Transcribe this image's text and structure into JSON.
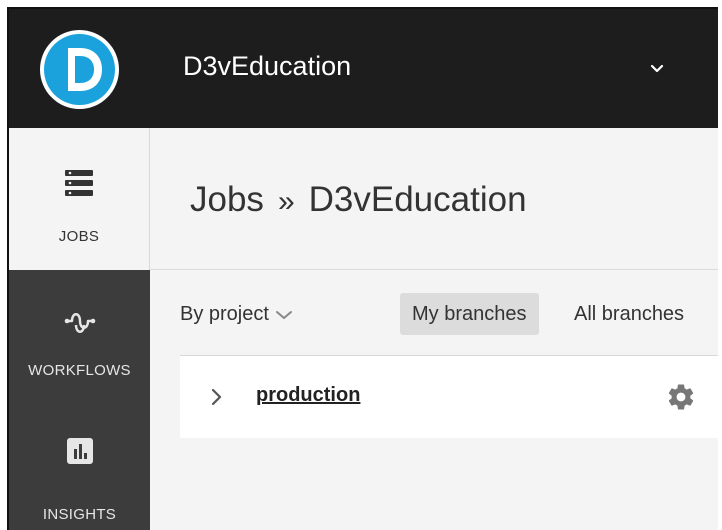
{
  "topbar": {
    "org_name": "D3vEducation",
    "logo_icon": "circleci-org-logo-icon",
    "org_menu_icon": "chevron-down-icon",
    "logo_color": "#1ba1dc",
    "background": "#1d1d1d"
  },
  "sidebar": {
    "items": [
      {
        "label": "JOBS",
        "icon": "jobs-stack-icon",
        "active": true
      },
      {
        "label": "WORKFLOWS",
        "icon": "workflows-icon",
        "active": false
      },
      {
        "label": "INSIGHTS",
        "icon": "insights-chart-icon",
        "active": false
      }
    ]
  },
  "main": {
    "breadcrumb": {
      "root": "Jobs",
      "separator": "»",
      "current": "D3vEducation"
    },
    "filter": {
      "group_by": "By project",
      "my_branches": "My branches",
      "all_branches": "All branches",
      "selected": "My branches"
    },
    "projects": [
      {
        "name": "production",
        "expand_icon": "chevron-right-icon",
        "settings_icon": "gear-icon"
      }
    ]
  }
}
